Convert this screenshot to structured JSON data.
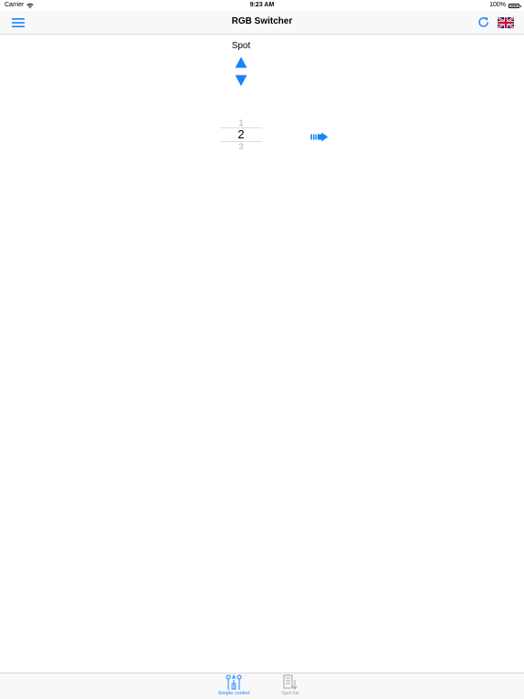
{
  "status_bar": {
    "carrier": "Carrier",
    "time": "9:23 AM",
    "battery": "100%"
  },
  "nav": {
    "title": "RGB Switcher",
    "left_icon": "menu-icon",
    "right_icons": [
      "refresh-icon",
      "uk-flag-icon"
    ]
  },
  "main": {
    "spot_label": "Spot",
    "picker": {
      "items": [
        "1",
        "2",
        "3"
      ],
      "selected": "2"
    }
  },
  "tabbar": {
    "tabs": [
      {
        "label": "Simple control",
        "icon": "sliders-icon",
        "active": true
      },
      {
        "label": "Spot list",
        "icon": "list-icon",
        "active": false
      }
    ]
  },
  "colors": {
    "accent": "#1a82fb",
    "inactive": "#a4a4a4",
    "bar_background": "#f8f8f8"
  }
}
